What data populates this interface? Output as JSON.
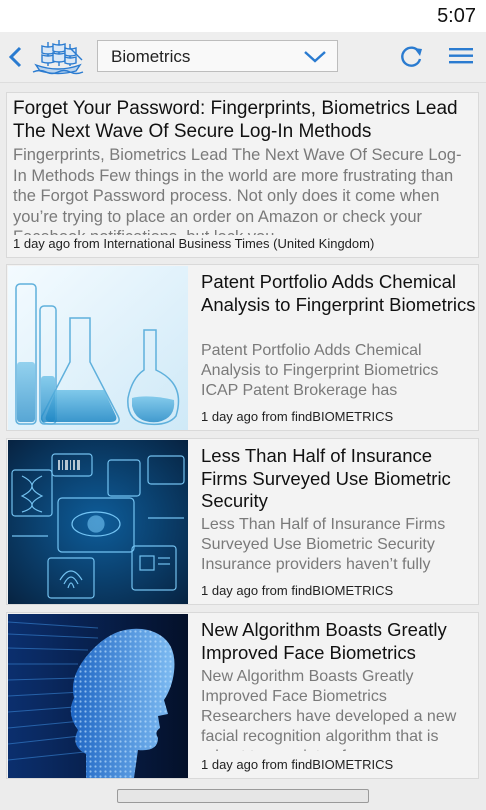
{
  "status": {
    "time": "5:07"
  },
  "toolbar": {
    "back_icon": "back-arrow-icon",
    "logo_icon": "sailing-ship-icon",
    "topic_value": "Biometrics",
    "dropdown_icon": "chevron-down-icon",
    "refresh_icon": "refresh-icon",
    "menu_icon": "hamburger-menu-icon"
  },
  "colors": {
    "accent": "#2a7bd0",
    "excerpt_text": "#7a7a7a",
    "card_bg": "#f3f3f3"
  },
  "articles": [
    {
      "title": "Forget Your Password: Fingerprints, Biometrics Lead The Next Wave Of Secure Log-In Methods",
      "excerpt": "Fingerprints, Biometrics Lead The Next Wave Of Secure Log-In Methods Few things in the world are more frustrating than the Forgot Password process. Not only does it come when you’re trying to place an order on Amazon or check your Facebook notifications, but lock you",
      "meta": "1 day ago from International Business Times (United Kingdom)"
    },
    {
      "title": "Patent Portfolio Adds Chemical Analysis to Fingerprint Biometrics",
      "excerpt": "Patent Portfolio Adds Chemical Analysis to Fingerprint Biometrics ICAP Patent Brokerage has announced the sale of a",
      "meta": "1 day ago from findBIOMETRICS",
      "image": "lab-glassware-image"
    },
    {
      "title": "Less Than Half of Insurance Firms Surveyed Use Biometric Security",
      "excerpt": "Less Than Half of Insurance Firms Surveyed Use Biometric Security Insurance providers haven’t fully embraced biometric",
      "meta": "1 day ago from findBIOMETRICS",
      "image": "biometric-security-graphic-image"
    },
    {
      "title": "New Algorithm Boasts Greatly Improved Face Biometrics",
      "excerpt": "New Algorithm Boasts Greatly Improved Face Biometrics Researchers have developed a new facial recognition algorithm that is robust to a variety of",
      "meta": "1 day ago from findBIOMETRICS",
      "image": "digital-face-image"
    }
  ]
}
